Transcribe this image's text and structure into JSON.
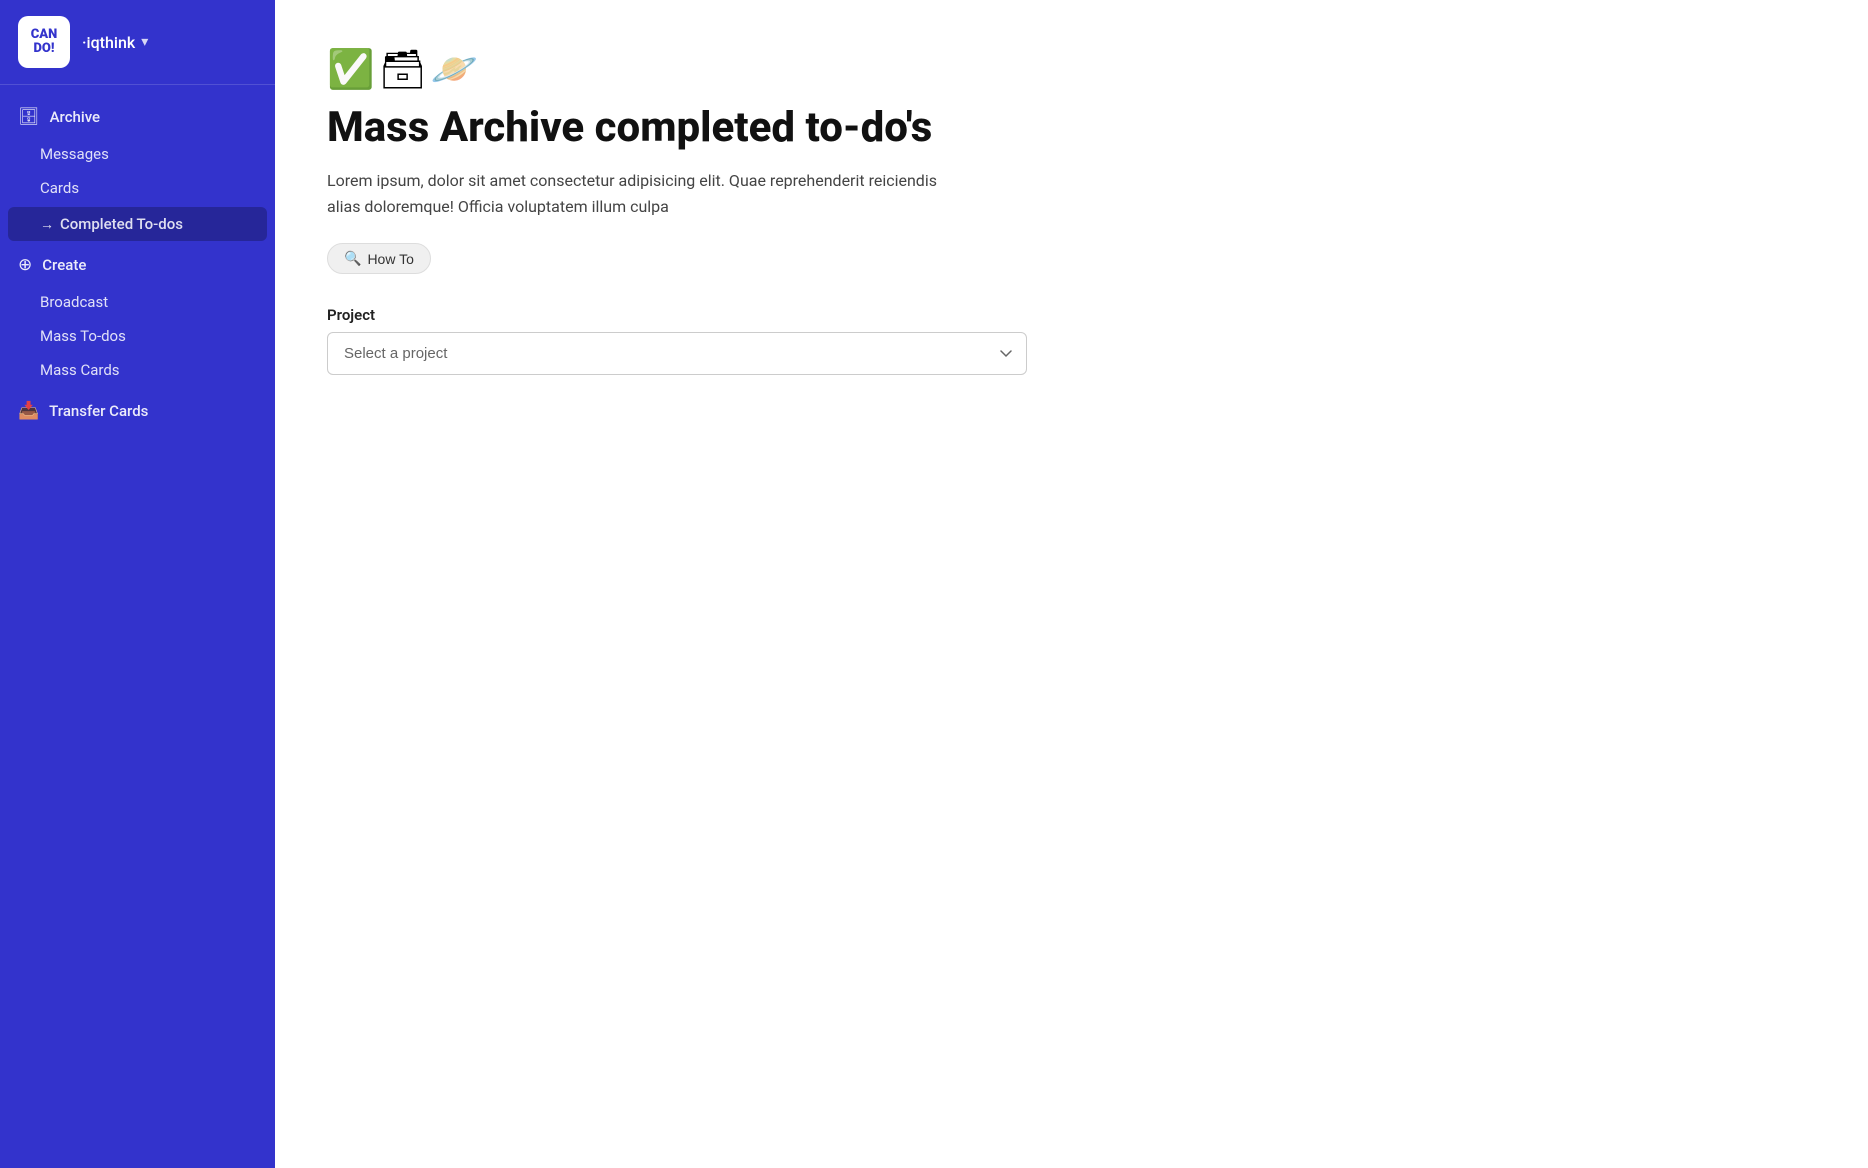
{
  "sidebar": {
    "logo": {
      "line1": "CAN",
      "line2": "DO!"
    },
    "workspace": "·iqthink",
    "chevron": "▾",
    "sections": [
      {
        "id": "archive",
        "icon": "🗄",
        "label": "Archive",
        "children": [
          {
            "id": "messages",
            "label": "Messages"
          },
          {
            "id": "cards",
            "label": "Cards"
          },
          {
            "id": "completed-todos",
            "label": "Completed To-dos",
            "active": true
          }
        ]
      },
      {
        "id": "create",
        "icon": "⊕",
        "label": "Create",
        "children": [
          {
            "id": "broadcast",
            "label": "Broadcast"
          },
          {
            "id": "mass-todos",
            "label": "Mass To-dos"
          },
          {
            "id": "mass-cards",
            "label": "Mass Cards"
          }
        ]
      },
      {
        "id": "transfer-cards",
        "icon": "📥",
        "label": "Transfer Cards",
        "children": []
      }
    ]
  },
  "main": {
    "icons": "✅🗃🪐",
    "title": "Mass Archive completed to-do's",
    "description": "Lorem ipsum, dolor sit amet consectetur adipisicing elit. Quae reprehenderit reiciendis alias doloremque! Officia voluptatem illum culpa",
    "how_to_btn": {
      "icon": "🔍",
      "label": "How To"
    },
    "project_field": {
      "label": "Project",
      "placeholder": "Select a project"
    }
  },
  "colors": {
    "sidebar_bg": "#3333cc",
    "active_item_bg": "rgba(0,0,0,0.25)",
    "main_bg": "#ffffff"
  }
}
